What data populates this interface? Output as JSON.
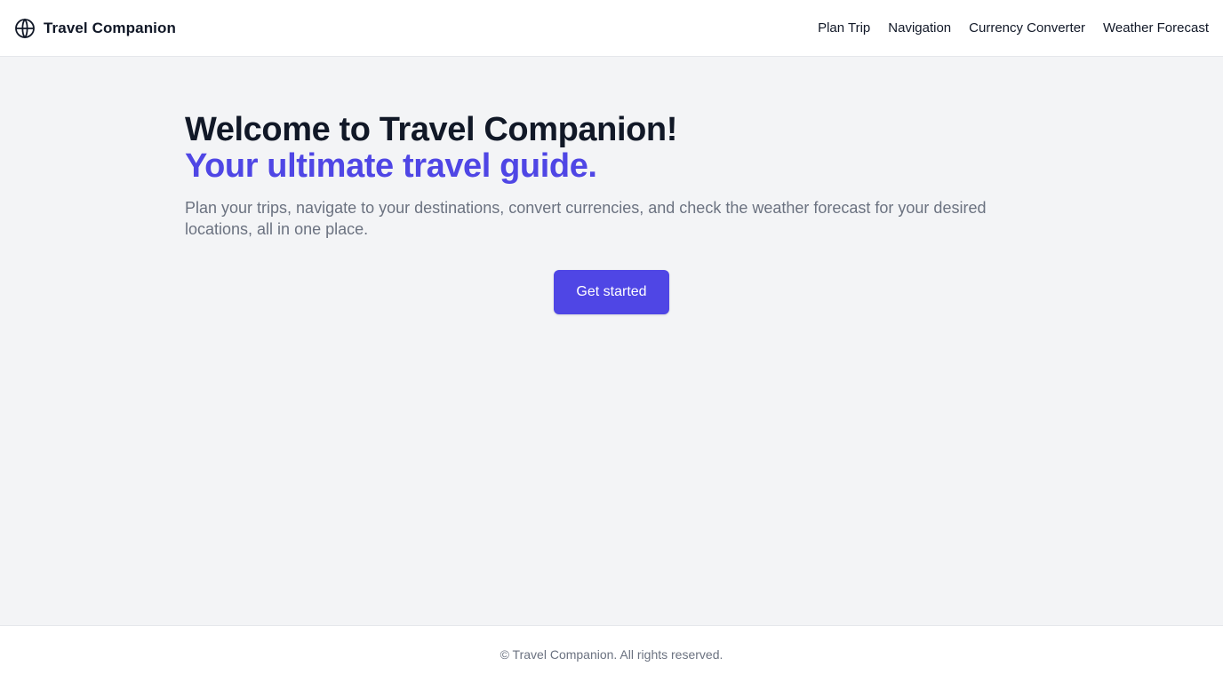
{
  "header": {
    "brand_name": "Travel Companion",
    "brand_icon": "globe-icon",
    "nav": [
      {
        "label": "Plan Trip"
      },
      {
        "label": "Navigation"
      },
      {
        "label": "Currency Converter"
      },
      {
        "label": "Weather Forecast"
      }
    ]
  },
  "hero": {
    "title": "Welcome to Travel Companion!",
    "subtitle": "Your ultimate travel guide.",
    "description": "Plan your trips, navigate to your destinations, convert currencies, and check the weather forecast for your desired locations, all in one place.",
    "cta_label": "Get started"
  },
  "footer": {
    "copyright": "© Travel Companion. All rights reserved."
  },
  "colors": {
    "accent": "#4f46e5",
    "background": "#f3f4f6",
    "text": "#111827",
    "muted": "#6b7280"
  }
}
